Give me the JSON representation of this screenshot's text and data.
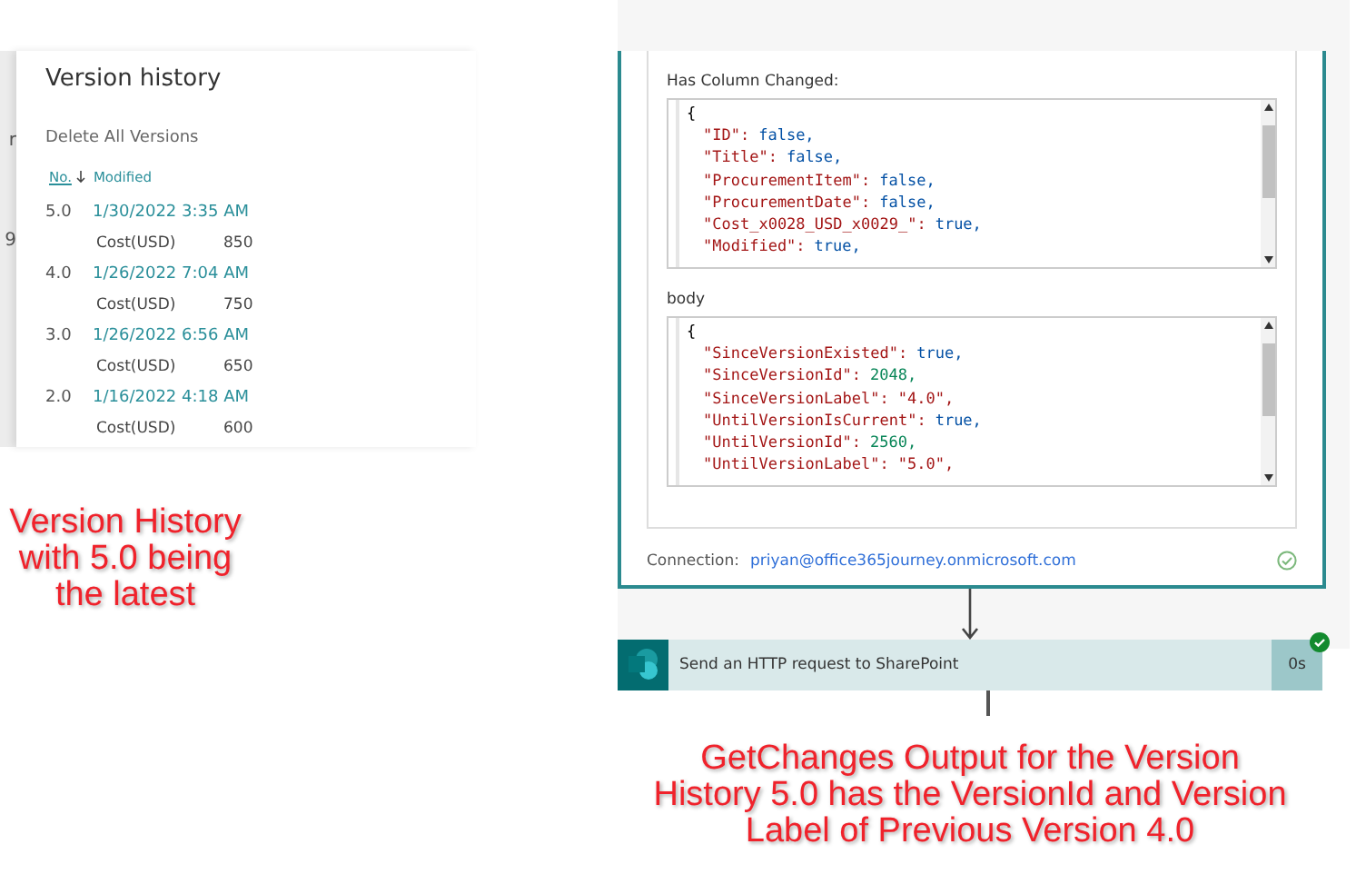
{
  "version_panel": {
    "edge_texts": [
      "r",
      "9"
    ],
    "title": "Version history",
    "delete_all": "Delete All Versions",
    "columns": [
      {
        "label": "No.",
        "sorted": true
      },
      {
        "label": "Modified",
        "sorted": false
      }
    ],
    "versions": [
      {
        "number": "5.0",
        "modified": "1/30/2022 3:35 AM",
        "field": "Cost(USD)",
        "value": "850"
      },
      {
        "number": "4.0",
        "modified": "1/26/2022 7:04 AM",
        "field": "Cost(USD)",
        "value": "750"
      },
      {
        "number": "3.0",
        "modified": "1/26/2022 6:56 AM",
        "field": "Cost(USD)",
        "value": "650"
      },
      {
        "number": "2.0",
        "modified": "1/16/2022 4:18 AM",
        "field": "Cost(USD)",
        "value": "600"
      }
    ]
  },
  "left_caption": "Version History with 5.0 being the latest",
  "flow_card": {
    "sections": [
      {
        "label": "Has Column Changed:",
        "lines": [
          {
            "key": "{",
            "kind": "brace"
          },
          {
            "key": "\"ID\":",
            "value": "false,",
            "kind": "boolean"
          },
          {
            "key": "\"Title\":",
            "value": "false,",
            "kind": "boolean"
          },
          {
            "key": "\"ProcurementItem\":",
            "value": "false,",
            "kind": "boolean"
          },
          {
            "key": "\"ProcurementDate\":",
            "value": "false,",
            "kind": "boolean"
          },
          {
            "key": "\"Cost_x0028_USD_x0029_\":",
            "value": "true,",
            "kind": "boolean"
          },
          {
            "key": "\"Modified\":",
            "value": "true,",
            "kind": "boolean"
          }
        ]
      },
      {
        "label": "body",
        "lines": [
          {
            "key": "{",
            "kind": "brace"
          },
          {
            "key": "\"SinceVersionExisted\":",
            "value": "true,",
            "kind": "boolean"
          },
          {
            "key": "\"SinceVersionId\":",
            "value": "2048,",
            "kind": "number"
          },
          {
            "key": "\"SinceVersionLabel\":",
            "value": "\"4.0\",",
            "kind": "string"
          },
          {
            "key": "\"UntilVersionIsCurrent\":",
            "value": "true,",
            "kind": "boolean"
          },
          {
            "key": "\"UntilVersionId\":",
            "value": "2560,",
            "kind": "number"
          },
          {
            "key": "\"UntilVersionLabel\":",
            "value": "\"5.0\",",
            "kind": "string"
          }
        ]
      }
    ],
    "connection_label": "Connection:",
    "connection": "priyan@office365journey.onmicrosoft.com"
  },
  "action": {
    "title": "Send an HTTP request to SharePoint",
    "duration": "0s",
    "succeeded": true
  },
  "right_caption": "GetChanges Output for the Version History 5.0 has the VersionId and Version Label of Previous Version 4.0"
}
